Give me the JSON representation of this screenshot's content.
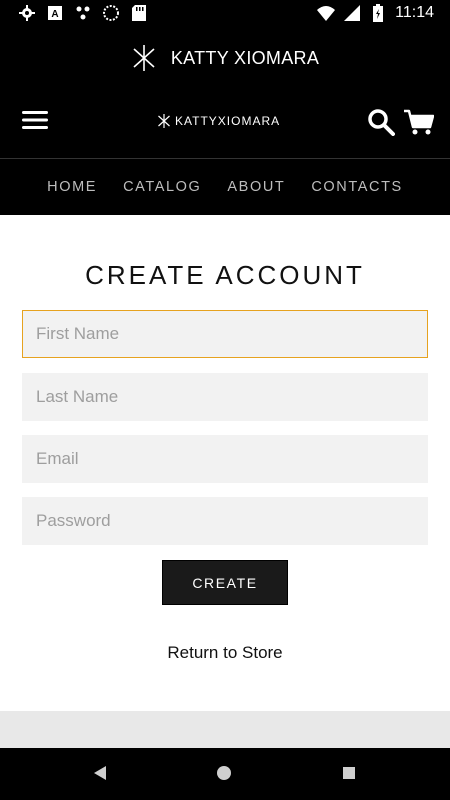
{
  "status_bar": {
    "time": "11:14",
    "icons": [
      "gear-icon",
      "a-icon",
      "network-icon",
      "circle-icon",
      "sd-card-icon",
      "wifi-icon",
      "signal-icon",
      "battery-icon"
    ]
  },
  "app_bar": {
    "title": "KATTY XIOMARA",
    "logo_icon": "asterisk-logo-icon"
  },
  "header": {
    "brand": "KATTYXIOMARA",
    "brand_icon": "asterisk-logo-icon",
    "menu_icon": "hamburger-menu-icon",
    "search_icon": "search-icon",
    "cart_icon": "cart-icon"
  },
  "nav": {
    "items": [
      {
        "label": "HOME"
      },
      {
        "label": "CATALOG"
      },
      {
        "label": "ABOUT"
      },
      {
        "label": "CONTACTS"
      }
    ]
  },
  "form": {
    "title": "CREATE ACCOUNT",
    "fields": {
      "first_name": {
        "placeholder": "First Name",
        "value": ""
      },
      "last_name": {
        "placeholder": "Last Name",
        "value": ""
      },
      "email": {
        "placeholder": "Email",
        "value": ""
      },
      "password": {
        "placeholder": "Password",
        "value": ""
      }
    },
    "submit_label": "CREATE",
    "return_link": "Return to Store"
  },
  "colors": {
    "background": "#000000",
    "content_bg": "#ffffff",
    "field_bg": "#f2f2f2",
    "focus_border": "#e6a21f",
    "button_bg": "#1a1a1a"
  },
  "system_nav": {
    "icons": [
      "back-icon",
      "home-icon",
      "recents-icon"
    ]
  }
}
